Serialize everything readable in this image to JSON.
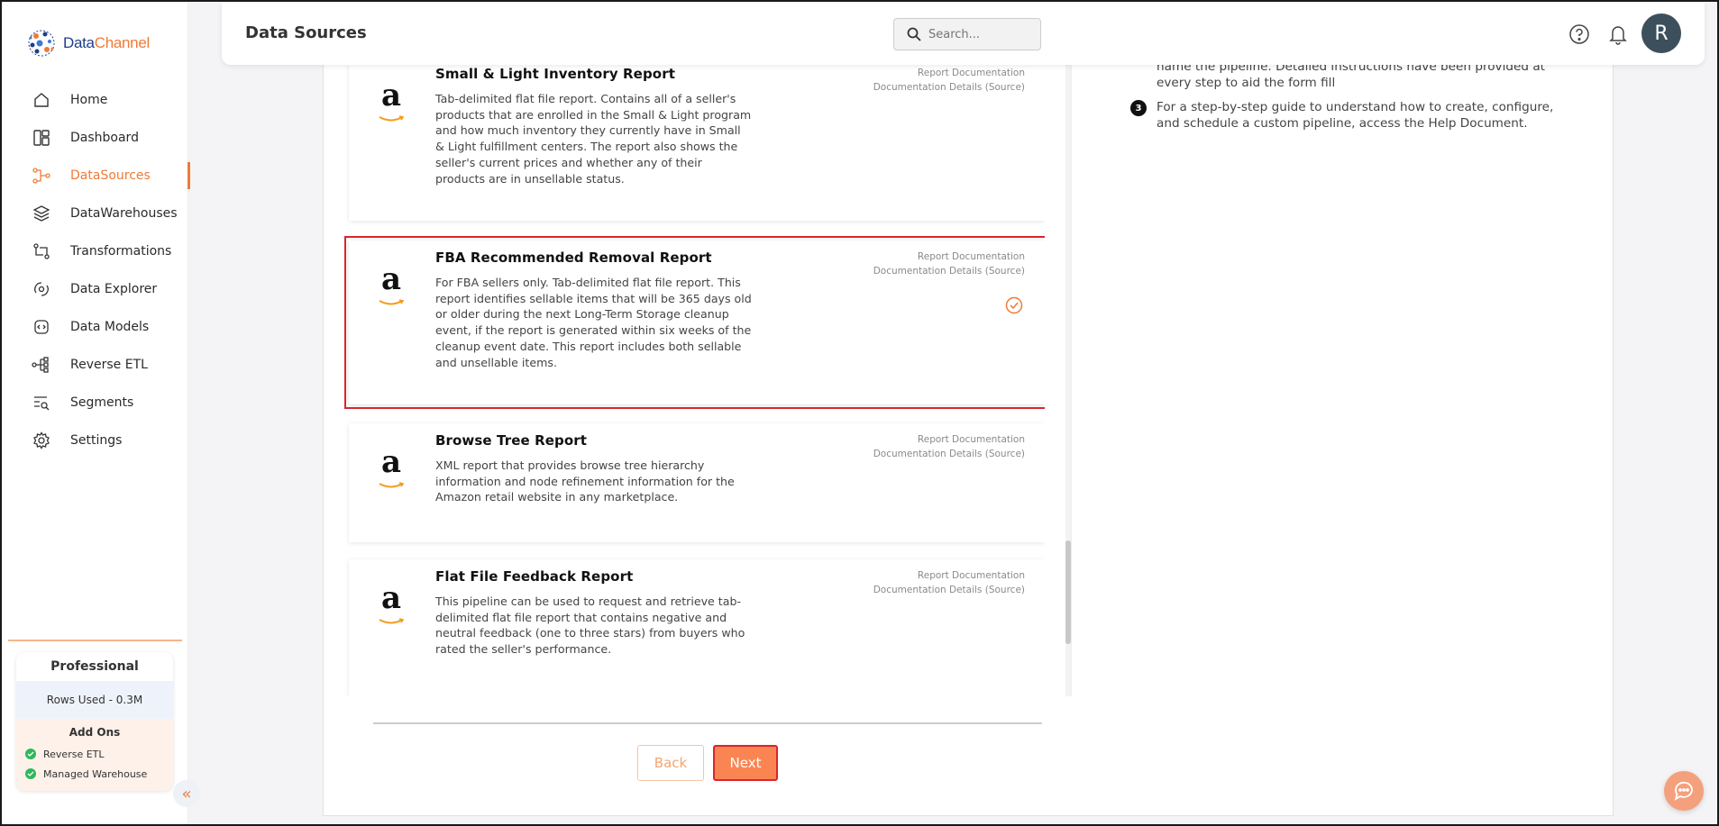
{
  "app": {
    "brand_part1": "Data",
    "brand_part2": "Channel",
    "accent_color": "#f07a35"
  },
  "header": {
    "title": "Data Sources",
    "search_placeholder": "Search...",
    "avatar_initial": "R"
  },
  "sidebar": {
    "items": [
      {
        "label": "Home",
        "icon": "home-icon"
      },
      {
        "label": "Dashboard",
        "icon": "dashboard-icon"
      },
      {
        "label": "DataSources",
        "icon": "datasources-icon",
        "active": true
      },
      {
        "label": "DataWarehouses",
        "icon": "layers-icon"
      },
      {
        "label": "Transformations",
        "icon": "transform-icon"
      },
      {
        "label": "Data Explorer",
        "icon": "explorer-icon"
      },
      {
        "label": "Data Models",
        "icon": "models-icon"
      },
      {
        "label": "Reverse ETL",
        "icon": "reverse-etl-icon"
      },
      {
        "label": "Segments",
        "icon": "segments-icon"
      },
      {
        "label": "Settings",
        "icon": "gear-icon"
      }
    ],
    "plan": {
      "name": "Professional",
      "rows_used": "Rows Used - 0.3M",
      "addons_title": "Add Ons",
      "addons": [
        "Reverse ETL",
        "Managed Warehouse"
      ]
    }
  },
  "reports": [
    {
      "title": "Small & Light Inventory Report",
      "description": "Tab-delimited flat file report. Contains all of a seller's products that are enrolled in the Small & Light program and how much inventory they currently have in Small & Light fulfillment centers. The report also shows the seller's current prices and whether any of their products are in unsellable status.",
      "link1": "Report Documentation",
      "link2": "Documentation Details (Source)",
      "selected": false
    },
    {
      "title": "FBA Recommended Removal Report",
      "description": "For FBA sellers only. Tab-delimited flat file report. This report identifies sellable items that will be 365 days old or older during the next Long-Term Storage cleanup event, if the report is generated within six weeks of the cleanup event date. This report includes both sellable and unsellable items.",
      "link1": "Report Documentation",
      "link2": "Documentation Details (Source)",
      "selected": true
    },
    {
      "title": "Browse Tree Report",
      "description": "XML report that provides browse tree hierarchy information and node refinement information for the Amazon retail website in any marketplace.",
      "link1": "Report Documentation",
      "link2": "Documentation Details (Source)",
      "selected": false
    },
    {
      "title": "Flat File Feedback Report",
      "description": "This pipeline can be used to request and retrieve tab-delimited flat file report that contains negative and neutral feedback (one to three stars) from buyers who rated the seller's performance.",
      "link1": "Report Documentation",
      "link2": "Documentation Details (Source)",
      "selected": false
    }
  ],
  "instructions": {
    "step2_partial_line1": "name the pipeline. Detailed instructions have been provided at",
    "step2_partial_line2": "every step to aid the form fill",
    "step3_number": "3",
    "step3_text": "For a step-by-step guide to understand how to create, configure, and schedule a custom pipeline, access the Help Document."
  },
  "footer": {
    "back_label": "Back",
    "next_label": "Next"
  }
}
